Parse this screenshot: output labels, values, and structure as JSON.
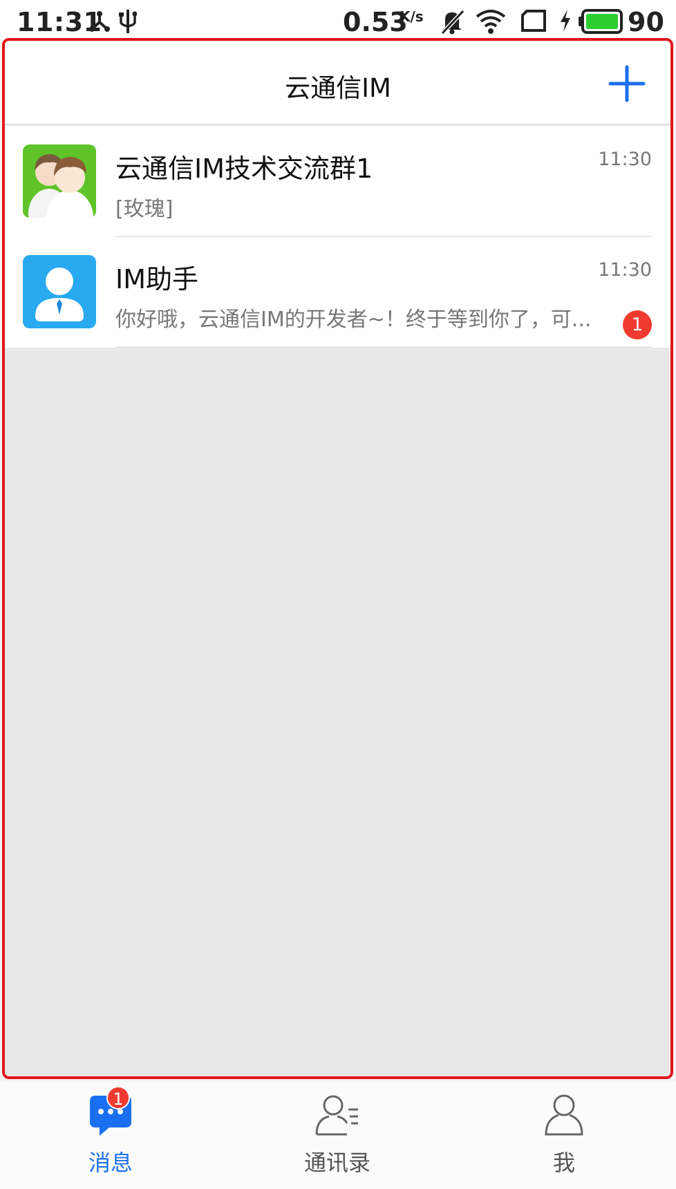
{
  "status_bar": {
    "time": "11:31",
    "network_speed": "0.53",
    "network_speed_unit": "K/s",
    "battery_level": "90",
    "icons": [
      "share-icon",
      "usb-icon",
      "bell-muted-icon",
      "wifi-icon",
      "screen-rotate-icon",
      "charging-icon",
      "battery-icon"
    ]
  },
  "header": {
    "title": "云通信IM",
    "add_icon": "plus-icon",
    "accent_color": "#1a6ff0"
  },
  "conversations": [
    {
      "title": "云通信IM技术交流群1",
      "time": "11:30",
      "preview": "[玫瑰]",
      "avatar": "group-avatar-icon",
      "unread": null
    },
    {
      "title": "IM助手",
      "time": "11:30",
      "preview": "你好哦，云通信IM的开发者~！终于等到你了，可...",
      "avatar": "assistant-avatar-icon",
      "unread": "1"
    }
  ],
  "tab_bar": {
    "tabs": [
      {
        "label": "消息",
        "icon": "chat-bubble-icon",
        "active": true,
        "badge": "1"
      },
      {
        "label": "通讯录",
        "icon": "contacts-icon",
        "active": false
      },
      {
        "label": "我",
        "icon": "profile-icon",
        "active": false
      }
    ]
  },
  "colors": {
    "unread_badge": "#f03a2f",
    "highlight_frame": "#e0161c",
    "empty_background": "#e8e8e8"
  }
}
